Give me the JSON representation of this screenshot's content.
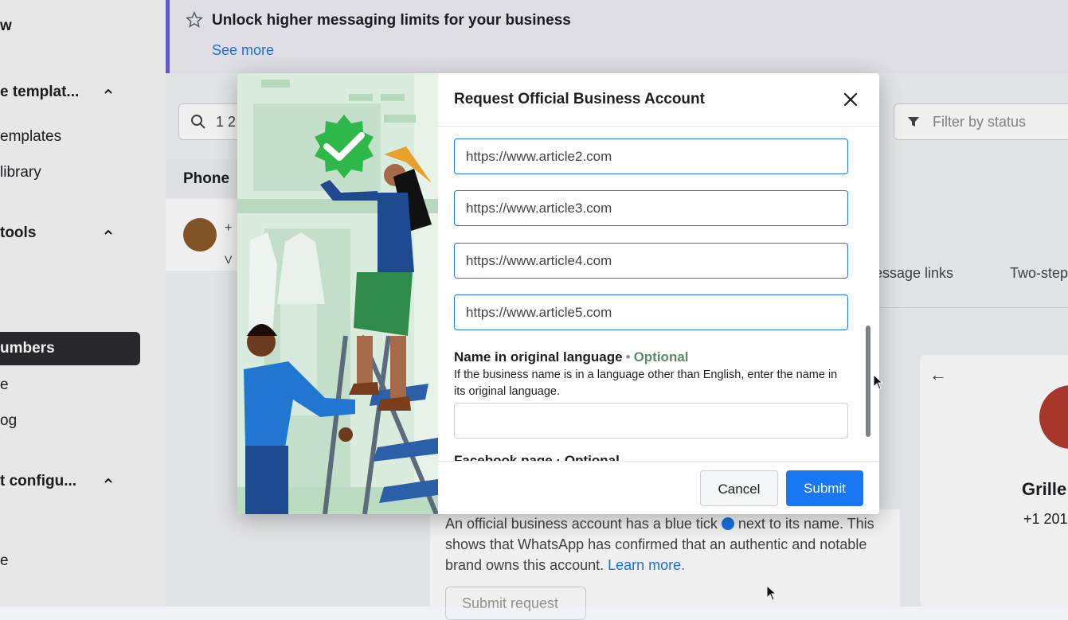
{
  "sidebar": {
    "items": [
      {
        "label": "w",
        "top": 0
      },
      {
        "label": "e templat...",
        "top": 0
      },
      {
        "label": "emplates",
        "top": 0
      },
      {
        "label": "library",
        "top": 0
      },
      {
        "label": "tools",
        "top": 0
      },
      {
        "label": "e",
        "top": 0
      },
      {
        "label": "og",
        "top": 0
      },
      {
        "label": "t configu...",
        "top": 0
      },
      {
        "label": "e",
        "top": 0
      }
    ],
    "active_label": "umbers"
  },
  "banner": {
    "title": "Unlock higher messaging limits for your business",
    "link": "See more"
  },
  "toolbar": {
    "search_value": "1 2",
    "filter_placeholder": "Filter by status"
  },
  "phone_list": {
    "header": "Phone",
    "row_prefix": "+",
    "row_suffix": "V"
  },
  "tabs": [
    "essage links",
    "Two-step"
  ],
  "profile": {
    "back_glyph": "←",
    "name": "Grille",
    "phone": "+1 201"
  },
  "info_card": {
    "text": "An official business account has a blue tick",
    "text2": "next to its name. This shows that WhatsApp has confirmed that an authentic and notable brand owns this account.",
    "learn_more": "Learn more.",
    "submit_request": "Submit request"
  },
  "modal": {
    "title": "Request Official Business Account",
    "close_glyph": "✕",
    "urls": [
      "https://www.article2.com",
      "https://www.article3.com",
      "https://www.article4.com",
      "https://www.article5.com"
    ],
    "name_label": "Name in original language",
    "optional": "Optional",
    "name_help": "If the business name is in a language other than English, enter the name in its original language.",
    "name_value": "",
    "next_label_cut": "Facebook page · Optional",
    "cancel": "Cancel",
    "submit": "Submit"
  },
  "colors": {
    "primary": "#1877f2",
    "banner_accent": "#6b5bd6",
    "badge_green": "#2fb84a"
  }
}
